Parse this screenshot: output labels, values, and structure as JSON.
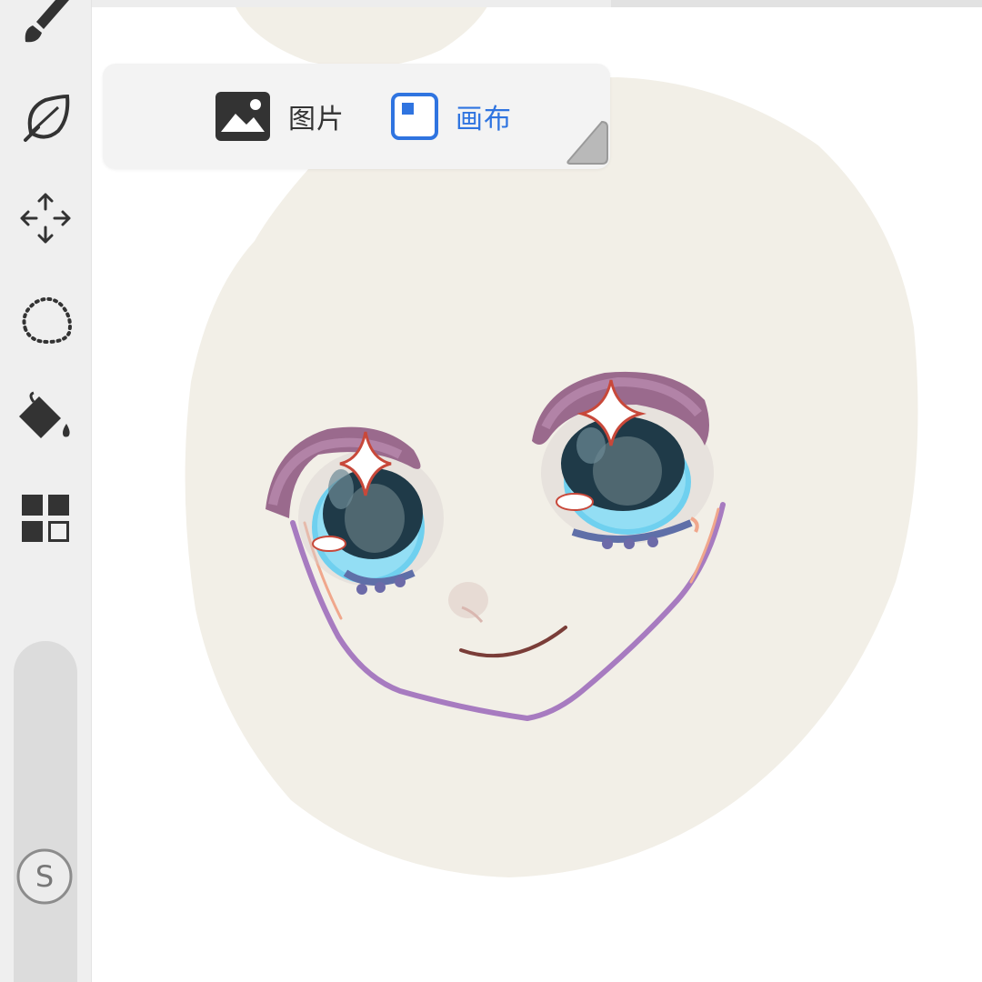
{
  "toolbar": {
    "tools": [
      {
        "icon": "brush-icon"
      },
      {
        "icon": "leaf-smudge-icon"
      },
      {
        "icon": "move-transform-icon"
      },
      {
        "icon": "lasso-select-icon"
      },
      {
        "icon": "paint-bucket-icon"
      },
      {
        "icon": "gallery-grid-icon"
      }
    ],
    "size_slider_button": "S"
  },
  "popup": {
    "image_option": {
      "icon": "image-icon",
      "label": "图片"
    },
    "canvas_option": {
      "icon": "canvas-icon",
      "label": "画布",
      "selected": true
    },
    "accent_color": "#2f74e0"
  },
  "canvas": {
    "background_color": "#ffffff",
    "face_color": "#f2efe7"
  }
}
